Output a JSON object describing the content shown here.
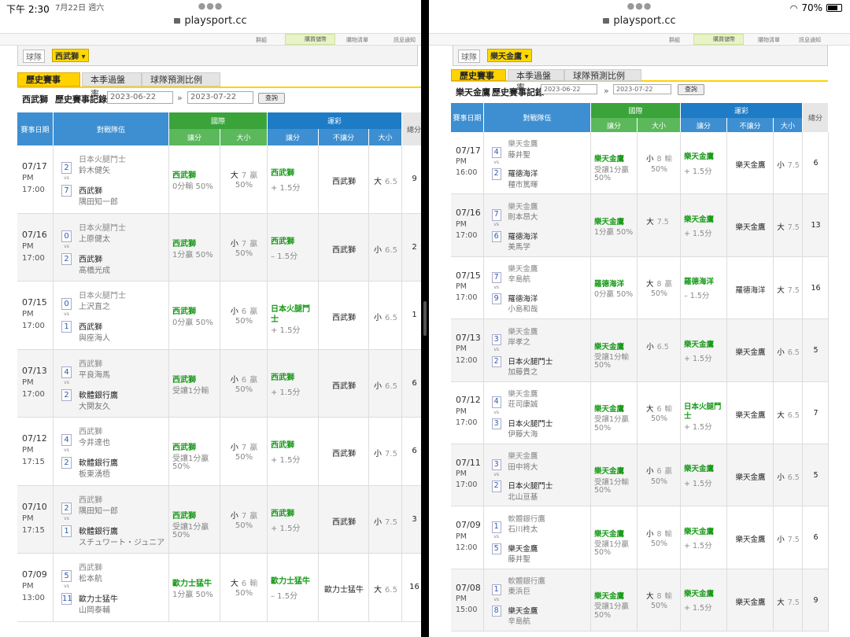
{
  "status": {
    "time": "下午 2:30",
    "date": "7月22日 週六",
    "battery": "70%"
  },
  "left": {
    "url": "playsport.cc",
    "nav": [
      "群組",
      "購買儲幣",
      "購物清單",
      "訊息通知"
    ],
    "team_label": "球隊",
    "team": "西武獅",
    "tabs": [
      "歷史賽事",
      "本季過盤率",
      "球隊預測比例"
    ],
    "filter_team": "西武獅",
    "filter_label": "歷史賽事記錄",
    "date_from": "2023-06-22",
    "date_to": "2023-07-22",
    "query": "查詢",
    "headers": {
      "date": "賽事日期",
      "teams": "對戰隊伍",
      "intl": "國際",
      "lottery": "運彩",
      "spread": "讓分",
      "ou": "大小",
      "nospread": "不讓分",
      "total": "總分"
    },
    "rows": [
      {
        "date": "07/17",
        "ampm": "PM",
        "time": "17:00",
        "s1": "2",
        "s2": "7",
        "away": "日本火腿鬥士",
        "away_p": "鈴木健矢",
        "home": "西武獅",
        "home_p": "隅田知一郎",
        "i_team": "西武獅",
        "i_sub": "0分輸 50%",
        "o_dir": "大",
        "o_num": "7",
        "o_res": "贏",
        "o_pct": "50%",
        "l_team": "西武獅",
        "l_sub": "+ 1.5分",
        "nl": "西武獅",
        "lo_dir": "大",
        "lo_num": "6.5",
        "total": "9"
      },
      {
        "date": "07/16",
        "ampm": "PM",
        "time": "17:00",
        "s1": "0",
        "s2": "2",
        "away": "日本火腿鬥士",
        "away_p": "上原健太",
        "home": "西武獅",
        "home_p": "髙橋光成",
        "i_team": "西武獅",
        "i_sub": "1分贏 50%",
        "o_dir": "小",
        "o_num": "7",
        "o_res": "贏",
        "o_pct": "50%",
        "l_team": "西武獅",
        "l_sub": "– 1.5分",
        "nl": "西武獅",
        "lo_dir": "小",
        "lo_num": "6.5",
        "total": "2"
      },
      {
        "date": "07/15",
        "ampm": "PM",
        "time": "17:00",
        "s1": "0",
        "s2": "1",
        "away": "日本火腿鬥士",
        "away_p": "上沢直之",
        "home": "西武獅",
        "home_p": "與座海人",
        "i_team": "西武獅",
        "i_sub": "0分贏 50%",
        "o_dir": "小",
        "o_num": "6",
        "o_res": "贏",
        "o_pct": "50%",
        "l_team": "日本火腿鬥士",
        "l_sub": "+ 1.5分",
        "nl": "西武獅",
        "lo_dir": "小",
        "lo_num": "6.5",
        "total": "1"
      },
      {
        "date": "07/13",
        "ampm": "PM",
        "time": "17:00",
        "s1": "4",
        "s2": "2",
        "away": "西武獅",
        "away_p": "平良海馬",
        "home": "軟體銀行鷹",
        "home_p": "大関友久",
        "i_team": "西武獅",
        "i_sub": "受讓1分輸",
        "o_dir": "小",
        "o_num": "6",
        "o_res": "贏",
        "o_pct": "50%",
        "l_team": "西武獅",
        "l_sub": "+ 1.5分",
        "nl": "西武獅",
        "lo_dir": "小",
        "lo_num": "6.5",
        "total": "6"
      },
      {
        "date": "07/12",
        "ampm": "PM",
        "time": "17:15",
        "s1": "4",
        "s2": "2",
        "away": "西武獅",
        "away_p": "今井達也",
        "home": "軟體銀行鷹",
        "home_p": "板東湧梧",
        "i_team": "西武獅",
        "i_sub": "受讓1分贏",
        "i_pct": "50%",
        "o_dir": "小",
        "o_num": "7",
        "o_res": "贏",
        "o_pct": "50%",
        "l_team": "西武獅",
        "l_sub": "+ 1.5分",
        "nl": "西武獅",
        "lo_dir": "小",
        "lo_num": "7.5",
        "total": "6"
      },
      {
        "date": "07/10",
        "ampm": "PM",
        "time": "17:15",
        "s1": "2",
        "s2": "1",
        "away": "西武獅",
        "away_p": "隅田知一郎",
        "home": "軟體銀行鷹",
        "home_p": "スチュワート・ジュニア",
        "i_team": "西武獅",
        "i_sub": "受讓1分贏",
        "i_pct": "50%",
        "o_dir": "小",
        "o_num": "7",
        "o_res": "贏",
        "o_pct": "50%",
        "l_team": "西武獅",
        "l_sub": "+ 1.5分",
        "nl": "西武獅",
        "lo_dir": "小",
        "lo_num": "7.5",
        "total": "3"
      },
      {
        "date": "07/09",
        "ampm": "PM",
        "time": "13:00",
        "s1": "5",
        "s2": "11",
        "away": "西武獅",
        "away_p": "松本航",
        "home": "歐力士猛牛",
        "home_p": "山岡泰輔",
        "i_team": "歐力士猛牛",
        "i_sub": "1分贏 50%",
        "o_dir": "大",
        "o_num": "6",
        "o_res": "輸",
        "o_pct": "50%",
        "l_team": "歐力士猛牛",
        "l_sub": "– 1.5分",
        "nl": "歐力士猛牛",
        "lo_dir": "大",
        "lo_num": "6.5",
        "total": "16"
      }
    ]
  },
  "right": {
    "url": "playsport.cc",
    "nav": [
      "群組",
      "購買儲幣",
      "購物清單",
      "訊息通知"
    ],
    "team_label": "球隊",
    "team": "樂天金鷹",
    "tabs": [
      "歷史賽事",
      "本季過盤率",
      "球隊預測比例"
    ],
    "filter_team": "樂天金鷹",
    "filter_label": "歷史賽事記錄",
    "date_from": "2023-06-22",
    "date_to": "2023-07-22",
    "query": "查詢",
    "headers": {
      "date": "賽事日期",
      "teams": "對戰隊伍",
      "intl": "國際",
      "lottery": "運彩",
      "spread": "讓分",
      "ou": "大小",
      "nospread": "不讓分",
      "total": "總分"
    },
    "rows": [
      {
        "date": "07/17",
        "ampm": "PM",
        "time": "16:00",
        "s1": "4",
        "s2": "2",
        "away": "樂天金鷹",
        "away_p": "藤井聖",
        "home": "羅德海洋",
        "home_p": "種市篤暉",
        "i_team": "樂天金鷹",
        "i_sub": "受讓1分贏",
        "i_pct": "50%",
        "o_dir": "小",
        "o_num": "8",
        "o_res": "輸",
        "o_pct": "50%",
        "l_team": "樂天金鷹",
        "l_sub": "+ 1.5分",
        "nl": "樂天金鷹",
        "lo_dir": "小",
        "lo_num": "7.5",
        "total": "6"
      },
      {
        "date": "07/16",
        "ampm": "PM",
        "time": "17:00",
        "s1": "7",
        "s2": "6",
        "away": "樂天金鷹",
        "away_p": "則本昂大",
        "home": "羅德海洋",
        "home_p": "美馬学",
        "i_team": "樂天金鷹",
        "i_sub": "1分贏 50%",
        "o_dir": "大",
        "o_num": "7.5",
        "o_res": "",
        "o_pct": "",
        "l_team": "樂天金鷹",
        "l_sub": "+ 1.5分",
        "nl": "樂天金鷹",
        "lo_dir": "大",
        "lo_num": "7.5",
        "total": "13"
      },
      {
        "date": "07/15",
        "ampm": "PM",
        "time": "17:00",
        "s1": "7",
        "s2": "9",
        "away": "樂天金鷹",
        "away_p": "辛島航",
        "home": "羅德海洋",
        "home_p": "小島和哉",
        "i_team": "羅德海洋",
        "i_sub": "0分贏 50%",
        "o_dir": "大",
        "o_num": "8",
        "o_res": "贏",
        "o_pct": "50%",
        "l_team": "羅德海洋",
        "l_sub": "– 1.5分",
        "nl": "羅德海洋",
        "lo_dir": "大",
        "lo_num": "7.5",
        "total": "16"
      },
      {
        "date": "07/13",
        "ampm": "PM",
        "time": "12:00",
        "s1": "3",
        "s2": "2",
        "away": "樂天金鷹",
        "away_p": "岸孝之",
        "home": "日本火腿鬥士",
        "home_p": "加藤貴之",
        "i_team": "樂天金鷹",
        "i_sub": "受讓1分輸",
        "i_pct": "50%",
        "o_dir": "小",
        "o_num": "6.5",
        "o_res": "",
        "o_pct": "",
        "l_team": "樂天金鷹",
        "l_sub": "+ 1.5分",
        "nl": "樂天金鷹",
        "lo_dir": "小",
        "lo_num": "6.5",
        "total": "5"
      },
      {
        "date": "07/12",
        "ampm": "PM",
        "time": "17:00",
        "s1": "4",
        "s2": "3",
        "away": "樂天金鷹",
        "away_p": "荘司康誠",
        "home": "日本火腿鬥士",
        "home_p": "伊藤大海",
        "i_team": "樂天金鷹",
        "i_sub": "受讓1分贏",
        "i_pct": "50%",
        "o_dir": "大",
        "o_num": "6",
        "o_res": "輸",
        "o_pct": "50%",
        "l_team": "日本火腿鬥士",
        "l_sub": "+ 1.5分",
        "nl": "樂天金鷹",
        "lo_dir": "大",
        "lo_num": "6.5",
        "total": "7"
      },
      {
        "date": "07/11",
        "ampm": "PM",
        "time": "17:00",
        "s1": "3",
        "s2": "2",
        "away": "樂天金鷹",
        "away_p": "田中将大",
        "home": "日本火腿鬥士",
        "home_p": "北山亘基",
        "i_team": "樂天金鷹",
        "i_sub": "受讓1分輸",
        "i_pct": "50%",
        "o_dir": "小",
        "o_num": "6",
        "o_res": "贏",
        "o_pct": "50%",
        "l_team": "樂天金鷹",
        "l_sub": "+ 1.5分",
        "nl": "樂天金鷹",
        "lo_dir": "小",
        "lo_num": "6.5",
        "total": "5"
      },
      {
        "date": "07/09",
        "ampm": "PM",
        "time": "12:00",
        "s1": "1",
        "s2": "5",
        "away": "軟體銀行鷹",
        "away_p": "石川柊太",
        "home": "樂天金鷹",
        "home_p": "藤井聖",
        "i_team": "樂天金鷹",
        "i_sub": "受讓1分贏",
        "i_pct": "50%",
        "o_dir": "小",
        "o_num": "8",
        "o_res": "輸",
        "o_pct": "50%",
        "l_team": "樂天金鷹",
        "l_sub": "+ 1.5分",
        "nl": "樂天金鷹",
        "lo_dir": "小",
        "lo_num": "7.5",
        "total": "6"
      },
      {
        "date": "07/08",
        "ampm": "PM",
        "time": "15:00",
        "s1": "1",
        "s2": "8",
        "away": "軟體銀行鷹",
        "away_p": "東浜巨",
        "home": "樂天金鷹",
        "home_p": "辛島航",
        "i_team": "樂天金鷹",
        "i_sub": "受讓1分贏",
        "i_pct": "50%",
        "o_dir": "大",
        "o_num": "8",
        "o_res": "輸",
        "o_pct": "50%",
        "l_team": "樂天金鷹",
        "l_sub": "+ 1.5分",
        "nl": "樂天金鷹",
        "lo_dir": "大",
        "lo_num": "7.5",
        "total": "9"
      }
    ]
  }
}
